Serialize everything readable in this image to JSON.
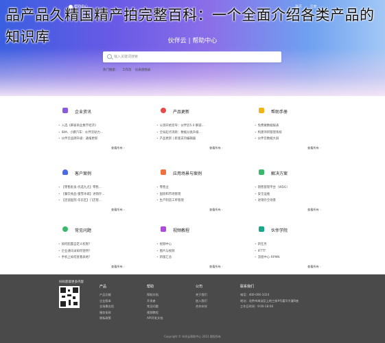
{
  "overlay_title": "品产品久精国精产拍完整百科：一个全面介绍各类产品的知识库",
  "topnav": {
    "logo": "帮助中心",
    "links": [
      "首页",
      "注册"
    ]
  },
  "hero": {
    "title": "伙伴云 | 帮助中心",
    "search_placeholder": "输入关键词搜索",
    "hot": [
      "热门搜索：",
      "工作流",
      "仪表盘图表"
    ]
  },
  "cards": [
    {
      "title": "企业资讯",
      "icon": "news-icon",
      "color": "#8a5ae0",
      "items": [
        "入选《麻省商业数字经济》",
        "IBM、小鹏汽车：伙伴云助力...",
        "伙伴云品牌升级：通报更新"
      ],
      "more": "查看所有"
    },
    {
      "title": "产品更新",
      "icon": "rocket-icon",
      "color": "#e84a4a",
      "items": [
        "公测开始宣导：伙伴云5.0 解锁...",
        "全局起点消耗：数据分类升级...",
        "产品更新 | 新版支持编辑器"
      ],
      "more": "查看所有"
    },
    {
      "title": "帮助手册",
      "icon": "book-icon",
      "color": "#f2b319",
      "items": [
        "免费做数据报表",
        "构建项目管理系统",
        "伙伴云数据大屏"
      ],
      "more": "查看所有"
    },
    {
      "title": "客户案例",
      "icon": "user-icon",
      "color": "#4a6ae8",
      "items": [
        "【零售批发-优选九尤】零售...",
        "【餐饮食品-蜜雪冰城】进销存...",
        "【连锁医院-华东区】门店管..."
      ],
      "more": "查看所有"
    },
    {
      "title": "应用场景与案例",
      "icon": "grid-icon",
      "color": "#f07040",
      "items": [
        "零售业",
        "国际和市场管理",
        "生产制造工单管理"
      ],
      "more": "查看所有"
    },
    {
      "title": "解决方案",
      "icon": "doc-icon",
      "color": "#3cb86a",
      "items": [
        "销售管理平台（WDG）",
        "安全运维",
        "进销存全场景"
      ],
      "more": "查看所有"
    },
    {
      "title": "常见问题",
      "icon": "question-icon",
      "color": "#3cb86a",
      "items": [
        "如何配置自定义权限？",
        "企业通讯录如何使用？",
        "手机上如何查看表格？"
      ],
      "more": "查看所有"
    },
    {
      "title": "视频教程",
      "icon": "video-icon",
      "color": "#b04ad8",
      "items": [
        "视频中心",
        "图片与视频",
        "新版汇总"
      ],
      "more": "查看所有"
    },
    {
      "title": "伙伴学院",
      "icon": "cap-icon",
      "color": "#18a88a",
      "items": [
        "新任务",
        "IFTTT",
        "流程中心-RPMN"
      ],
      "more": "查看所有"
    }
  ],
  "footer": {
    "qr_label": "扫码获取更多内容",
    "columns": [
      {
        "title": "产品",
        "items": [
          "产品功能",
          "企业版本",
          "全场景应用",
          "服务条款",
          "隐私政策"
        ]
      },
      {
        "title": "帮助",
        "items": [
          "帮助文档",
          "开发者",
          "常见问题",
          "视频教程",
          "API开发文档"
        ]
      },
      {
        "title": "公司",
        "items": [
          "关于我们",
          "加入我们",
          "合作伙伴"
        ]
      },
      {
        "title": "联系我们",
        "items": [
          "电话：400-006-1024",
          "地址：北京市海淀区上地三街9号嘉华大厦B座",
          "工作日时间：9:00-18:00"
        ]
      }
    ],
    "copyright": "Copyright © 伙伴云帮助中心 2021 版权所有"
  }
}
